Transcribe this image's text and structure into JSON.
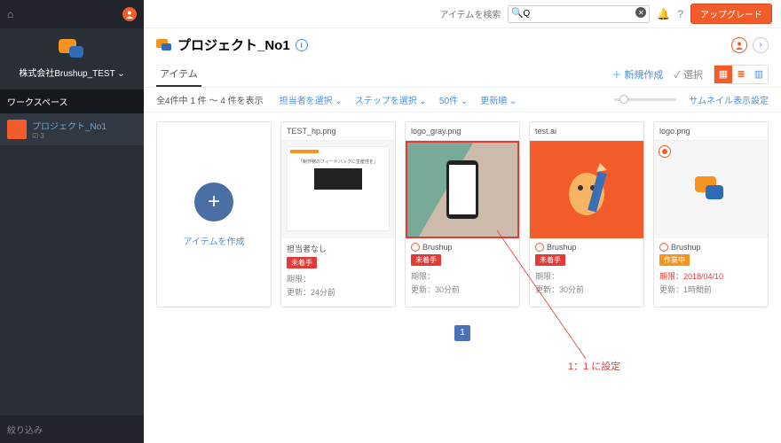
{
  "sidebar": {
    "org_name": "株式会社Brushup_TEST ⌄",
    "workspace_header": "ワークスペース",
    "projects": [
      {
        "label": "プロジェクト_No1",
        "count": "3"
      }
    ],
    "filter_label": "絞り込み"
  },
  "topbar": {
    "search_label": "アイテムを検索",
    "search_value": "Q",
    "upgrade": "アップグレード"
  },
  "project": {
    "title": "プロジェクト_No1"
  },
  "tabs": {
    "items_tab": "アイテム",
    "new_action": "＋ 新規作成",
    "select_action": "✓ 選択"
  },
  "filters": {
    "count_text": "全4件中 1 件 〜 4 件を表示",
    "assignee": "担当者を選択 ⌄",
    "step": "ステップを選択 ⌄",
    "per_page": "50件 ⌄",
    "sort": "更新順 ⌄",
    "thumb_setting": "サムネイル表示設定"
  },
  "new_card": {
    "label": "アイテムを作成"
  },
  "items": [
    {
      "title": "TEST_hp.png",
      "assignee": "担当者なし",
      "badge": "未着手",
      "badge_color": "red",
      "deadline_label": "期限：",
      "deadline_value": "",
      "updated": "更新：24分前",
      "selected": false,
      "thumb": "doc",
      "pin": false
    },
    {
      "title": "logo_gray.png",
      "assignee": "Brushup",
      "badge": "未着手",
      "badge_color": "red",
      "deadline_label": "期限：",
      "deadline_value": "",
      "updated": "更新：30分前",
      "selected": true,
      "thumb": "photo",
      "pin": false
    },
    {
      "title": "test.ai",
      "assignee": "Brushup",
      "badge": "未着手",
      "badge_color": "red",
      "deadline_label": "期限：",
      "deadline_value": "",
      "updated": "更新：30分前",
      "selected": false,
      "thumb": "mascot",
      "pin": false
    },
    {
      "title": "logo.png",
      "assignee": "Brushup",
      "badge": "作業中",
      "badge_color": "orange",
      "deadline_label": "期限：",
      "deadline_value": "2018/04/10",
      "deadline_red": true,
      "updated": "更新：1時間前",
      "selected": false,
      "thumb": "logo",
      "pin": true
    }
  ],
  "pager": {
    "page": "1"
  },
  "annotation": {
    "text": "1：1 に設定"
  }
}
